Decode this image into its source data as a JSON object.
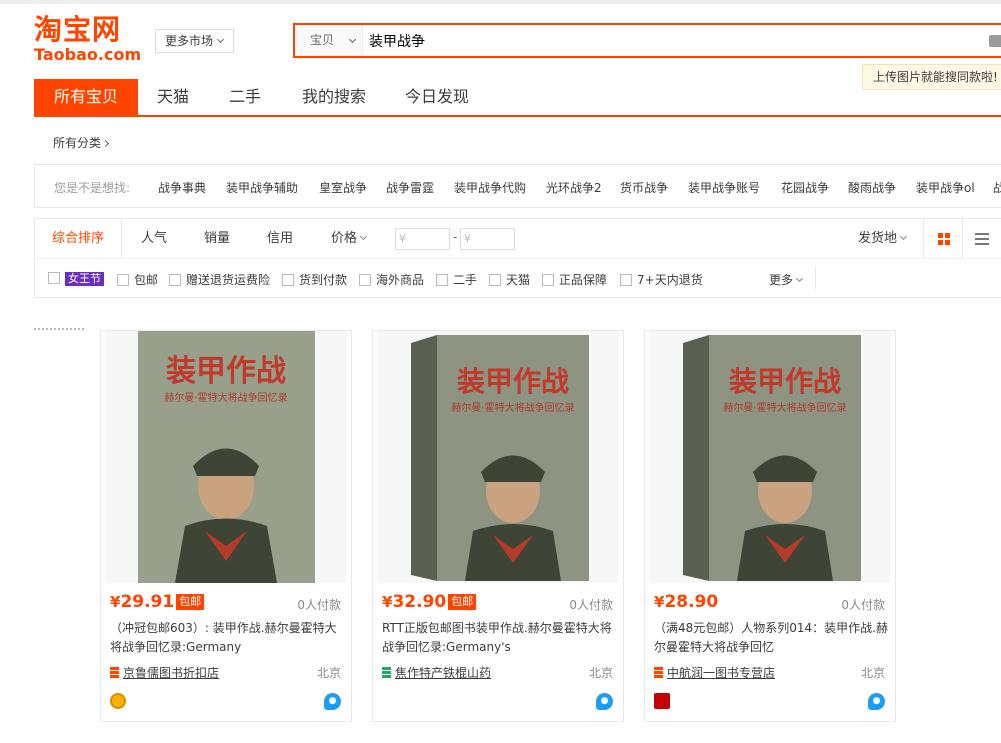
{
  "logo": {
    "cn": "淘宝网",
    "en": "Taobao.com"
  },
  "market_select": "更多市场",
  "search": {
    "category": "宝贝",
    "query": "装甲战争"
  },
  "upload_tip": "上传图片就能搜同款啦!",
  "tabs": [
    "所有宝贝",
    "天猫",
    "二手",
    "我的搜索",
    "今日发现"
  ],
  "all_categories": "所有分类",
  "suggestions": {
    "label": "您是不是想找:",
    "items": [
      "战争事典",
      "装甲战争辅助",
      "皇室战争",
      "战争雷霆",
      "装甲战争代购",
      "光环战争2",
      "货币战争",
      "装甲战争账号",
      "花园战争",
      "酸雨战争",
      "装甲战争ol",
      "战"
    ]
  },
  "sort": {
    "items": [
      "综合排序",
      "人气",
      "销量",
      "信用",
      "价格"
    ],
    "price_min_placeholder": "¥",
    "price_max_placeholder": "¥",
    "dash": "-",
    "ship_from": "发货地"
  },
  "filters": {
    "first_badge": "女王节",
    "items": [
      "包邮",
      "赠送退货运费险",
      "货到付款",
      "海外商品",
      "二手",
      "天猫",
      "正品保障",
      "7+天内退货"
    ],
    "more": "更多"
  },
  "colors": {
    "accent": "#ff4400",
    "badge_purple": "#6b2fbf",
    "wangwang": "#1e9cf0"
  },
  "products": [
    {
      "price_symbol": "¥",
      "price": "29.91",
      "tag": "包邮",
      "deals": "0人付款",
      "title": "（冲冠包邮603）: 装甲作战.赫尔曼霍特大将战争回忆录:Germany",
      "shop": "京鲁儒图书折扣店",
      "location": "北京",
      "cover": {
        "title": "装甲作战",
        "subtitle": "赫尔曼·霍特大将战争回忆录"
      }
    },
    {
      "price_symbol": "¥",
      "price": "32.90",
      "tag": "包邮",
      "deals": "0人付款",
      "title": "RTT正版包邮图书装甲作战.赫尔曼霍特大将战争回忆录:Germany's",
      "shop": "焦作特产铁棍山药",
      "location": "北京",
      "cover": {
        "title": "装甲作战",
        "subtitle": "赫尔曼·霍特大将战争回忆录"
      }
    },
    {
      "price_symbol": "¥",
      "price": "28.90",
      "tag": "",
      "deals": "0人付款",
      "title": "（满48元包邮）人物系列014：装甲作战.赫尔曼霍特大将战争回忆",
      "shop": "中航润一图书专营店",
      "location": "北京",
      "cover": {
        "title": "装甲作战",
        "subtitle": "赫尔曼·霍特大将战争回忆录"
      }
    }
  ]
}
